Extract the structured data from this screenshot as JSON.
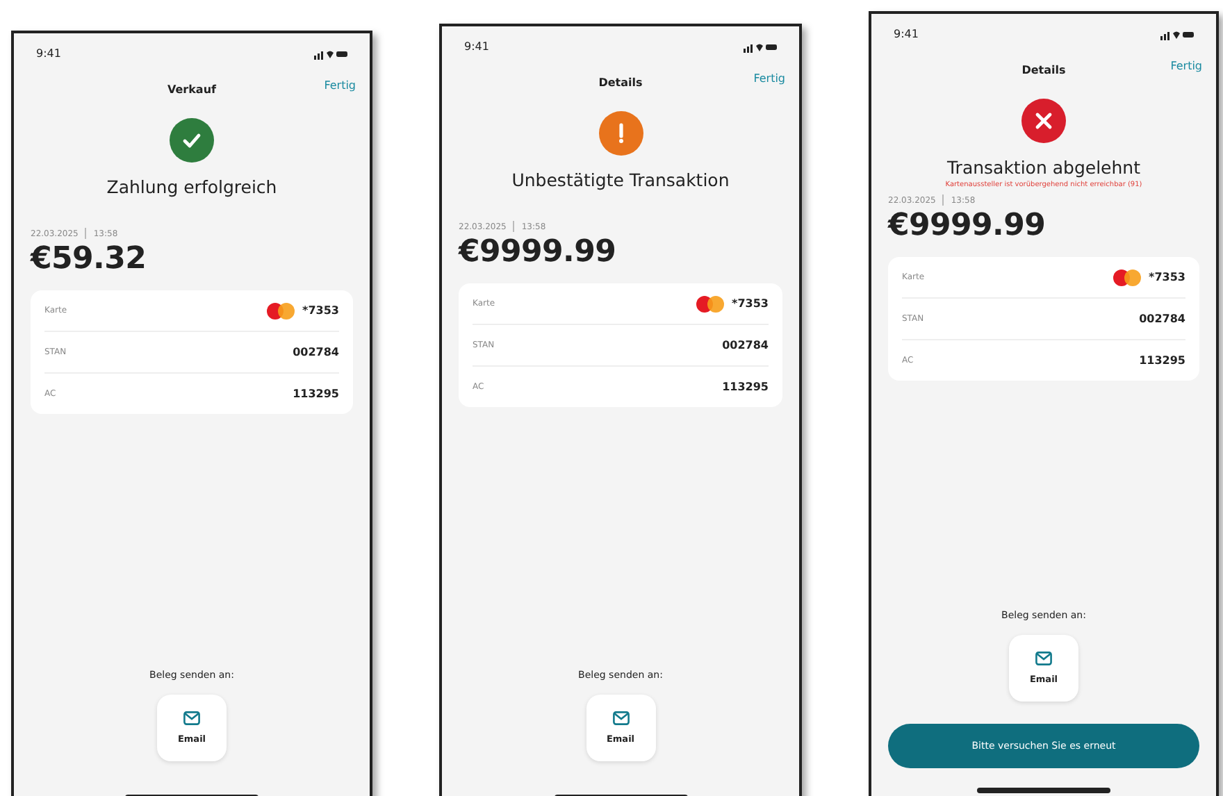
{
  "screens": [
    {
      "status_time": "9:41",
      "nav_title": "Verkauf",
      "done": "Fertig",
      "kind": "success",
      "status_title": "Zahlung erfolgreich",
      "date": "22.03.2025",
      "time": "13:58",
      "amount": "€59.32",
      "rows": [
        {
          "kind": "card",
          "label": "Karte",
          "value": "*7353"
        },
        {
          "kind": "text",
          "label": "STAN",
          "value": "002784"
        },
        {
          "kind": "text",
          "label": "AC",
          "value": "113295"
        }
      ],
      "receipt_label": "Beleg senden an:",
      "email": "Email"
    },
    {
      "status_time": "9:41",
      "nav_title": "Details",
      "done": "Fertig",
      "kind": "warning",
      "status_title": "Unbestätigte Transaktion",
      "date": "22.03.2025",
      "time": "13:58",
      "amount": "€9999.99",
      "rows": [
        {
          "kind": "card",
          "label": "Karte",
          "value": "*7353"
        },
        {
          "kind": "text",
          "label": "STAN",
          "value": "002784"
        },
        {
          "kind": "text",
          "label": "AC",
          "value": "113295"
        }
      ],
      "receipt_label": "Beleg senden an:",
      "email": "Email"
    },
    {
      "status_time": "9:41",
      "nav_title": "Details",
      "done": "Fertig",
      "kind": "error",
      "status_title": "Transaktion abgelehnt",
      "error_message": "Kartenaussteller ist vorübergehend nicht erreichbar (91)",
      "date": "22.03.2025",
      "time": "13:58",
      "amount": "€9999.99",
      "rows": [
        {
          "kind": "card",
          "label": "Karte",
          "value": "*7353"
        },
        {
          "kind": "text",
          "label": "STAN",
          "value": "002784"
        },
        {
          "kind": "text",
          "label": "AC",
          "value": "113295"
        }
      ],
      "receipt_label": "Beleg senden an:",
      "email": "Email",
      "retry_button": "Bitte versuchen Sie es erneut"
    }
  ]
}
